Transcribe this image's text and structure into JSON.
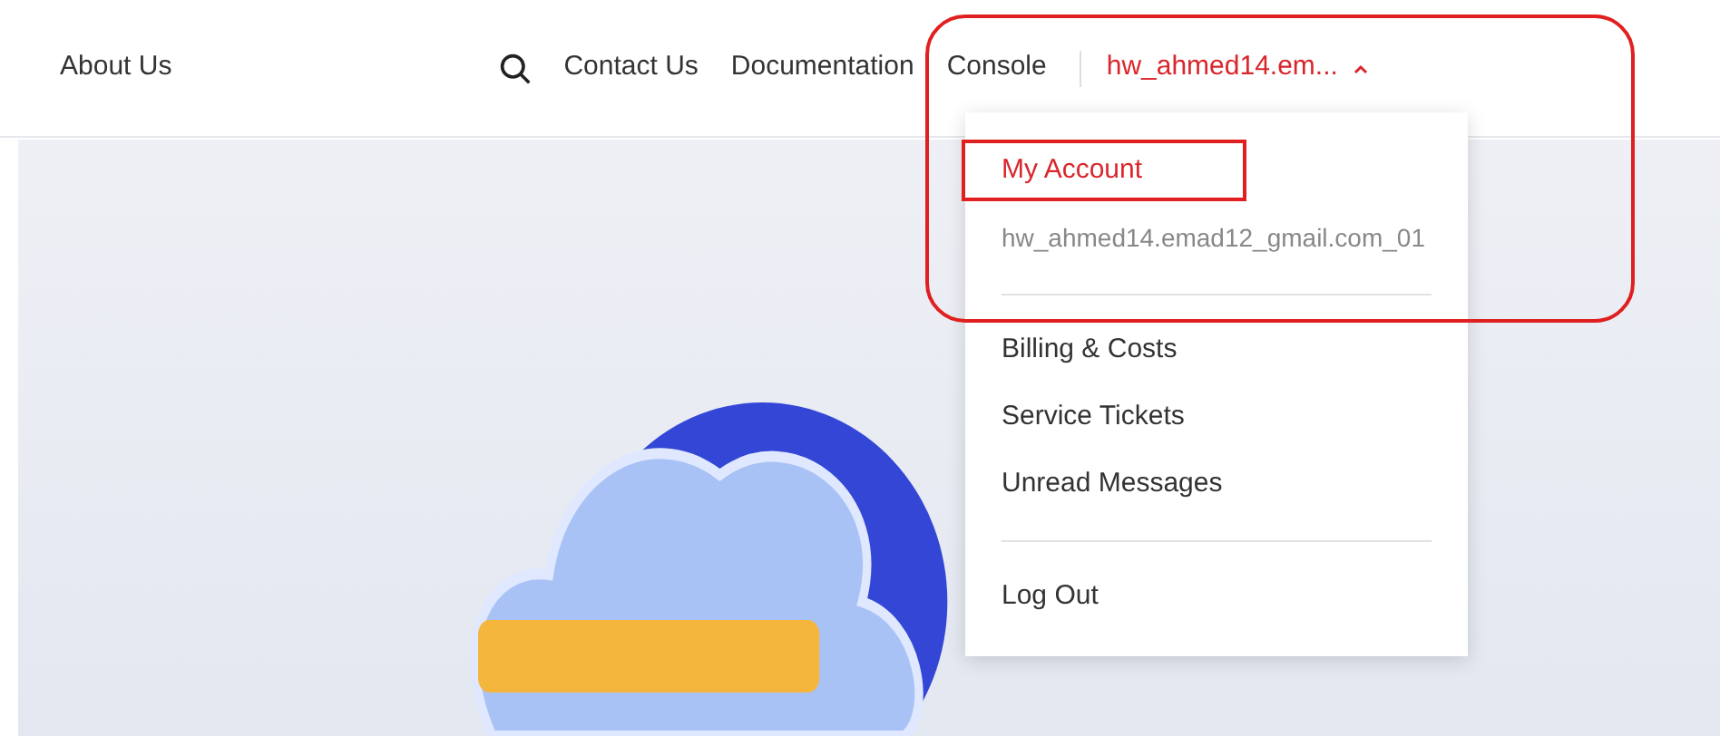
{
  "nav": {
    "left_link": "About Us",
    "links": [
      "Contact Us",
      "Documentation",
      "Console"
    ],
    "user": {
      "name": "hw_ahmed14.em...",
      "expanded": true
    }
  },
  "menu": {
    "items": [
      {
        "kind": "account",
        "label": "My Account"
      },
      {
        "kind": "info",
        "label": "hw_ahmed14.emad12_gmail.com_01"
      },
      {
        "kind": "divider"
      },
      {
        "kind": "link",
        "label": "Billing & Costs"
      },
      {
        "kind": "link",
        "label": "Service Tickets"
      },
      {
        "kind": "link",
        "label": "Unread Messages"
      },
      {
        "kind": "divider"
      },
      {
        "kind": "link",
        "label": "Log Out"
      }
    ]
  }
}
